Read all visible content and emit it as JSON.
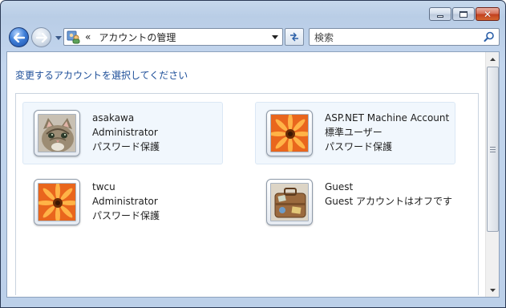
{
  "window": {
    "buttons": {
      "minimize": "minimize",
      "maximize": "maximize",
      "close": "close"
    }
  },
  "nav": {
    "back": "back",
    "forward": "forward",
    "recent": "recent-pages"
  },
  "address": {
    "chevron": "«",
    "path": "アカウントの管理"
  },
  "search": {
    "placeholder": "検索"
  },
  "content": {
    "task_title": "変更するアカウントを選択してください",
    "accounts": [
      {
        "name": "asakawa",
        "type": "Administrator",
        "status": "パスワード保護",
        "picture": "kitten",
        "selected": true
      },
      {
        "name": "ASP.NET Machine Account",
        "type": "標準ユーザー",
        "status": "パスワード保護",
        "picture": "flower",
        "selected": true
      },
      {
        "name": "twcu",
        "type": "Administrator",
        "status": "パスワード保護",
        "picture": "flower",
        "selected": false
      },
      {
        "name": "Guest",
        "type": "Guest アカウントはオフです",
        "status": "",
        "picture": "suitcase",
        "selected": false
      }
    ]
  },
  "colors": {
    "link_blue": "#1e4f99",
    "selected_tile": "#f1f7fd",
    "frame": "#bcd0e9"
  }
}
